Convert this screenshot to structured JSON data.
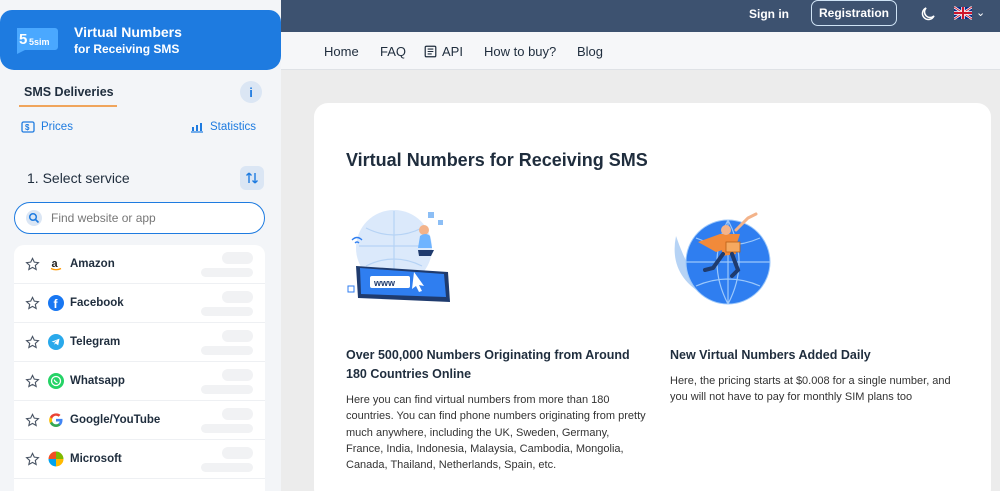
{
  "header": {
    "sign_in": "Sign in",
    "registration": "Registration",
    "theme_icon": "moon-icon",
    "language_icon": "uk-flag-icon"
  },
  "nav": {
    "items": [
      {
        "label": "Home"
      },
      {
        "label": "FAQ"
      },
      {
        "label": "API",
        "icon": "api-doc-icon"
      },
      {
        "label": "How to buy?"
      },
      {
        "label": "Blog"
      }
    ]
  },
  "brand": {
    "logo_text": "5sim",
    "title": "Virtual Numbers",
    "subtitle": "for Receiving SMS",
    "color": "#1e7be0"
  },
  "sidebar": {
    "active_tab": "SMS Deliveries",
    "info_label": "i",
    "prices": "Prices",
    "statistics": "Statistics",
    "select_title": "1. Select service",
    "search_placeholder": "Find website or app",
    "services": [
      {
        "name": "Amazon",
        "icon": "amazon-icon"
      },
      {
        "name": "Facebook",
        "icon": "facebook-icon"
      },
      {
        "name": "Telegram",
        "icon": "telegram-icon"
      },
      {
        "name": "Whatsapp",
        "icon": "whatsapp-icon"
      },
      {
        "name": "Google/YouTube",
        "icon": "google-icon"
      },
      {
        "name": "Microsoft",
        "icon": "microsoft-icon"
      }
    ]
  },
  "main": {
    "title": "Virtual Numbers for Receiving SMS",
    "feature1": {
      "illustration_text": "www",
      "title": "Over 500,000 Numbers Originating from Around 180 Countries Online",
      "description": "Here you can find virtual numbers from more than 180 countries. You can find phone numbers originating from pretty much anywhere, including the UK, Sweden, Germany, France, India, Indonesia, Malaysia, Cambodia, Mongolia, Canada, Thailand, Netherlands, Spain, etc."
    },
    "feature2": {
      "title": "New Virtual Numbers Added Daily",
      "description": "Here, the pricing starts at $0.008 for a single number, and you will not have to pay for monthly SIM plans too"
    }
  }
}
